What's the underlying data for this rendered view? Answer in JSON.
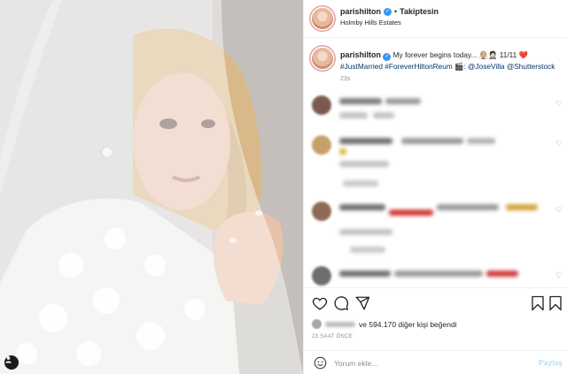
{
  "post": {
    "username": "parishilton",
    "follow_status": "Takiptesin",
    "location": "Holmby Hills Estates",
    "caption_text": "My forever begins today... 👰🏼🤵🏻 11/11 ❤️",
    "caption_tags": "#JustMarried #ForeverHiltonReum 🎬: @JoseVilla @Shutterstock",
    "caption_time": "23s",
    "likes_text": "ve 594.170 diğer kişi beğendi",
    "date": "23 SAAT ÖNCE"
  },
  "comment_input": {
    "placeholder": "Yorum ekle...",
    "post_label": "Paylaş"
  },
  "icons": [
    "verified-icon",
    "heart-icon",
    "comment-icon",
    "share-icon",
    "bookmark-icon",
    "emoji-icon",
    "tag-user-icon"
  ],
  "colors": {
    "link": "#00376b",
    "verified": "#3897f0",
    "muted": "#8e8e8e",
    "post_disabled": "#b2dffc"
  }
}
